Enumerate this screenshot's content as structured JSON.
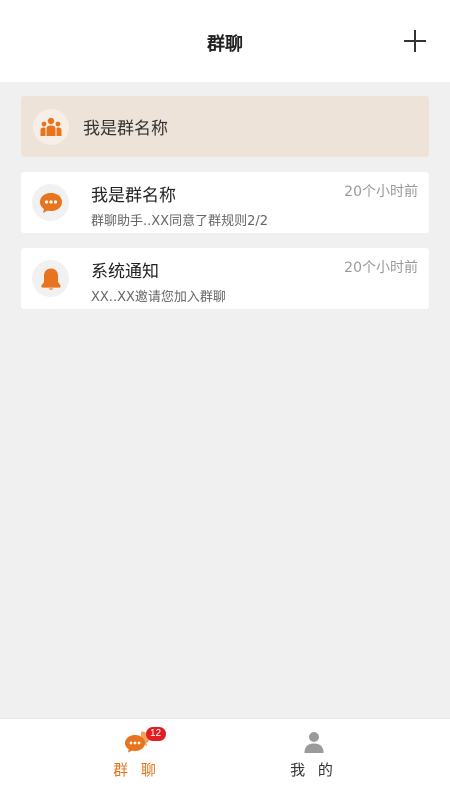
{
  "header": {
    "title": "群聊",
    "add_icon": "plus-icon"
  },
  "group_card": {
    "icon": "group-people-icon",
    "label": "我是群名称"
  },
  "conversations": [
    {
      "icon": "chat-bubble-icon",
      "title": "我是群名称",
      "subtitle": "群聊助手..XX同意了群规则2/2",
      "time": "20个小时前"
    },
    {
      "icon": "bell-icon",
      "title": "系统通知",
      "subtitle": "XX..XX邀请您加入群聊",
      "time": "20个小时前"
    }
  ],
  "tabbar": {
    "tabs": [
      {
        "label": "群 聊",
        "icon": "chat-bubble-icon",
        "badge": "12",
        "active": true
      },
      {
        "label": "我 的",
        "icon": "person-icon",
        "active": false
      }
    ]
  },
  "colors": {
    "accent": "#e8741e",
    "badge": "#e02020",
    "group_card_bg": "#eee3d8",
    "page_bg": "#f0f0f0"
  }
}
